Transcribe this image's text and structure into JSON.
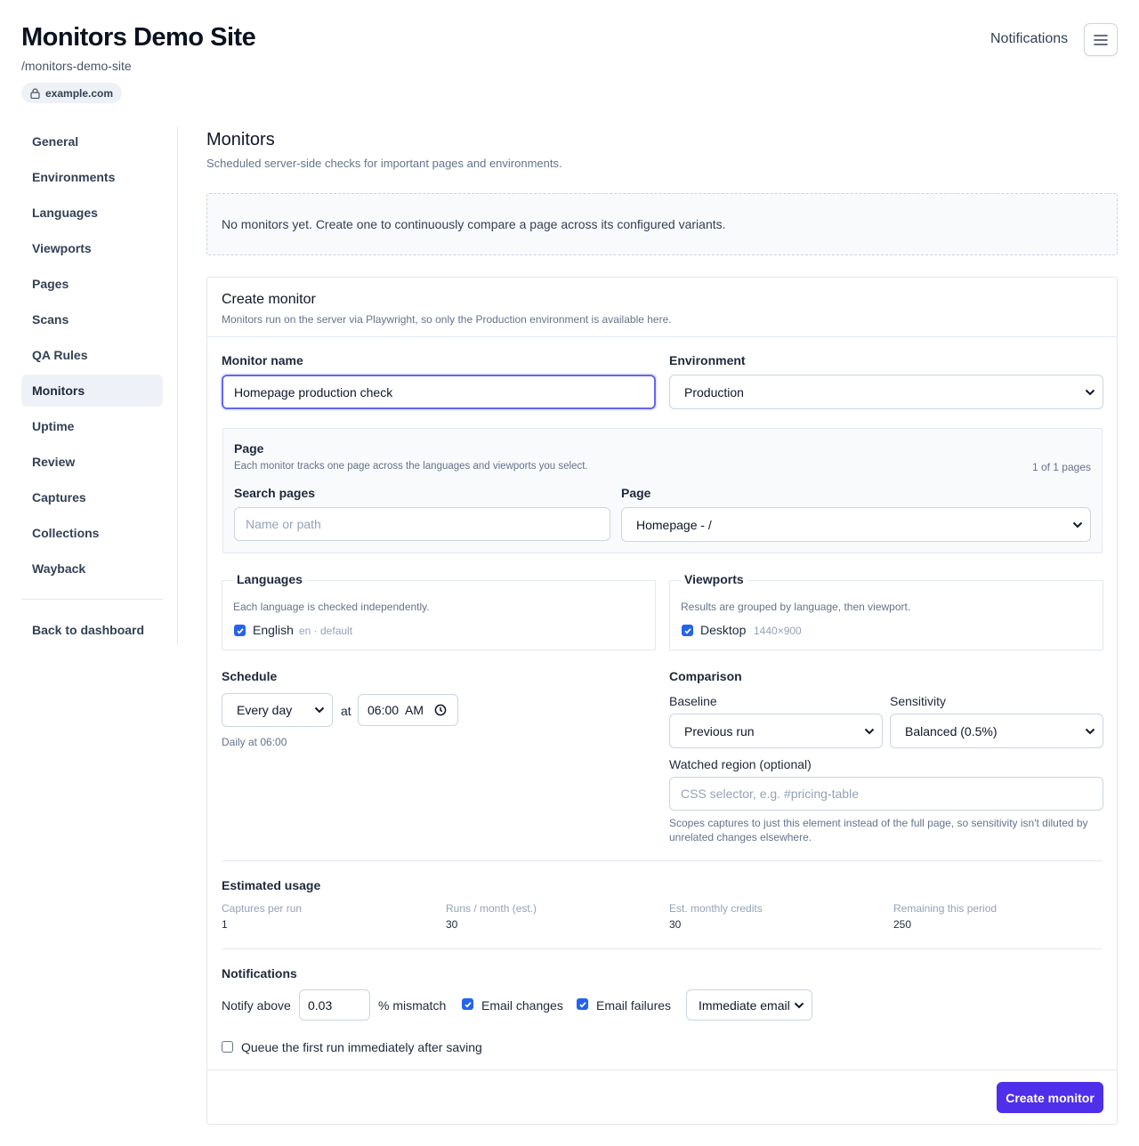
{
  "header": {
    "title": "Monitors Demo Site",
    "slug": "/monitors-demo-site",
    "domain": "example.com",
    "notifications_label": "Notifications"
  },
  "sidebar": {
    "items": [
      {
        "label": "General"
      },
      {
        "label": "Environments"
      },
      {
        "label": "Languages"
      },
      {
        "label": "Viewports"
      },
      {
        "label": "Pages"
      },
      {
        "label": "Scans"
      },
      {
        "label": "QA Rules"
      },
      {
        "label": "Monitors",
        "active": true
      },
      {
        "label": "Uptime"
      },
      {
        "label": "Review"
      },
      {
        "label": "Captures"
      },
      {
        "label": "Collections"
      },
      {
        "label": "Wayback"
      }
    ],
    "back_label": "Back to dashboard"
  },
  "main": {
    "title": "Monitors",
    "subtitle": "Scheduled server-side checks for important pages and environments.",
    "empty_text": "No monitors yet. Create one to continuously compare a page across its configured variants."
  },
  "form": {
    "title": "Create monitor",
    "subtitle": "Monitors run on the server via Playwright, so only the Production environment is available here.",
    "monitor_name_label": "Monitor name",
    "monitor_name_value": "Homepage production check",
    "environment_label": "Environment",
    "environment_value": "Production",
    "page_section": {
      "title": "Page",
      "help": "Each monitor tracks one page across the languages and viewports you select.",
      "count": "1 of 1 pages",
      "search_label": "Search pages",
      "search_placeholder": "Name or path",
      "page_label": "Page",
      "page_value": "Homepage - /"
    },
    "languages": {
      "legend": "Languages",
      "help": "Each language is checked independently.",
      "item_label": "English",
      "item_meta": "en · default",
      "checked": true
    },
    "viewports": {
      "legend": "Viewports",
      "help": "Results are grouped by language, then viewport.",
      "item_label": "Desktop",
      "item_meta": "1440×900",
      "checked": true
    },
    "schedule": {
      "label": "Schedule",
      "frequency": "Every day",
      "at_label": "at",
      "time": "06:00  AM",
      "summary": "Daily at 06:00"
    },
    "comparison": {
      "label": "Comparison",
      "baseline_label": "Baseline",
      "baseline_value": "Previous run",
      "sensitivity_label": "Sensitivity",
      "sensitivity_value": "Balanced (0.5%)",
      "region_label": "Watched region (optional)",
      "region_placeholder": "CSS selector, e.g. #pricing-table",
      "region_help_1": "Scopes captures to just this element instead of the full page, so sensitivity isn't diluted by",
      "region_help_2": "unrelated changes elsewhere."
    },
    "usage": {
      "title": "Estimated usage",
      "items": [
        {
          "label": "Captures per run",
          "value": "1"
        },
        {
          "label": "Runs / month (est.)",
          "value": "30"
        },
        {
          "label": "Est. monthly credits",
          "value": "30"
        },
        {
          "label": "Remaining this period",
          "value": "250"
        }
      ]
    },
    "notifications": {
      "title": "Notifications",
      "notify_above_label": "Notify above",
      "threshold": "0.03",
      "mismatch_label": "% mismatch",
      "email_changes_label": "Email changes",
      "email_changes_checked": true,
      "email_failures_label": "Email failures",
      "email_failures_checked": true,
      "delivery_value": "Immediate email",
      "queue_label": "Queue the first run immediately after saving",
      "queue_checked": false
    },
    "submit_label": "Create monitor"
  },
  "colors": {
    "accent": "#4f2fe9",
    "checkbox": "#2563eb",
    "focus_border": "#6366f1"
  }
}
